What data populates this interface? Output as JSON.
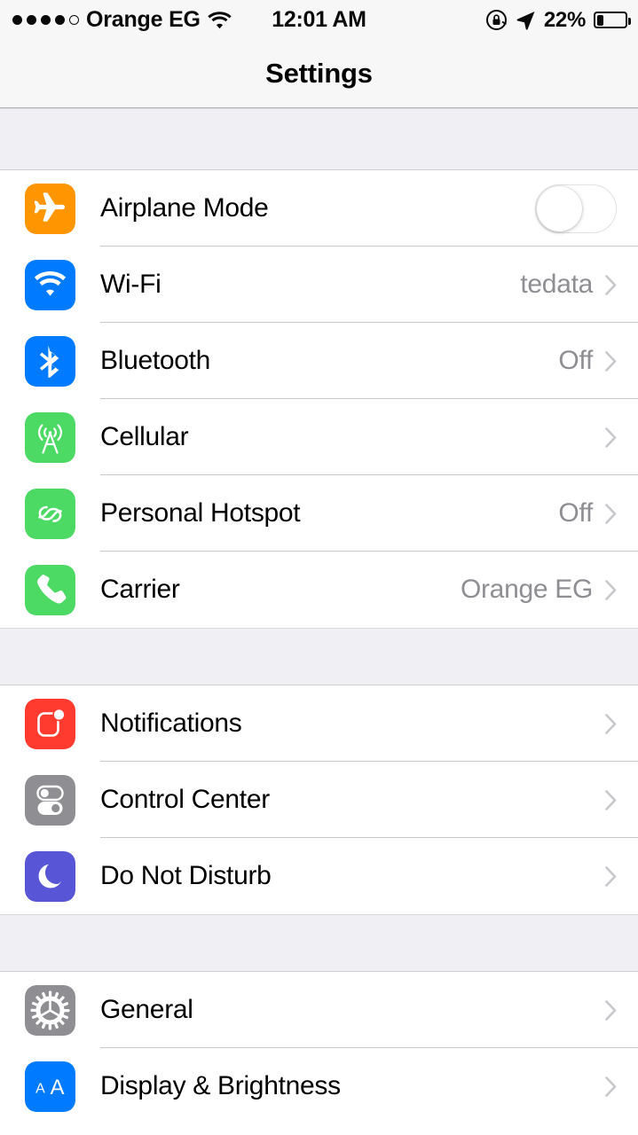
{
  "status_bar": {
    "signal_dots_filled": 4,
    "signal_dots_total": 5,
    "carrier": "Orange EG",
    "wifi_icon": "wifi-icon",
    "time": "12:01 AM",
    "rotation_lock_icon": "rotation-lock-icon",
    "location_icon": "location-arrow-icon",
    "battery_percent": "22%",
    "battery_level": 22
  },
  "navbar": {
    "title": "Settings"
  },
  "sections": [
    {
      "id": "connectivity",
      "rows": [
        {
          "label": "Airplane Mode",
          "icon": "airplane-icon",
          "icon_color": "#ff9500",
          "control": "toggle",
          "toggle_on": false
        },
        {
          "label": "Wi-Fi",
          "icon": "wifi-icon",
          "icon_color": "#007aff",
          "value": "tedata",
          "control": "chevron"
        },
        {
          "label": "Bluetooth",
          "icon": "bluetooth-icon",
          "icon_color": "#007aff",
          "value": "Off",
          "control": "chevron"
        },
        {
          "label": "Cellular",
          "icon": "cellular-antenna-icon",
          "icon_color": "#4cd964",
          "value": "",
          "control": "chevron"
        },
        {
          "label": "Personal Hotspot",
          "icon": "hotspot-link-icon",
          "icon_color": "#4cd964",
          "value": "Off",
          "control": "chevron"
        },
        {
          "label": "Carrier",
          "icon": "phone-icon",
          "icon_color": "#4cd964",
          "value": "Orange EG",
          "control": "chevron"
        }
      ]
    },
    {
      "id": "alerts",
      "rows": [
        {
          "label": "Notifications",
          "icon": "notifications-badge-icon",
          "icon_color": "#ff3b30",
          "value": "",
          "control": "chevron"
        },
        {
          "label": "Control Center",
          "icon": "control-center-toggles-icon",
          "icon_color": "#8e8e93",
          "value": "",
          "control": "chevron"
        },
        {
          "label": "Do Not Disturb",
          "icon": "moon-icon",
          "icon_color": "#5856d6",
          "value": "",
          "control": "chevron"
        }
      ]
    },
    {
      "id": "system",
      "rows": [
        {
          "label": "General",
          "icon": "gear-icon",
          "icon_color": "#8e8e93",
          "value": "",
          "control": "chevron"
        },
        {
          "label": "Display & Brightness",
          "icon": "text-size-aa-icon",
          "icon_color": "#007aff",
          "value": "",
          "control": "chevron",
          "icon_text": "AA"
        }
      ]
    }
  ],
  "colors": {
    "background": "#ffffff",
    "group_gap": "#efeff4",
    "separator": "#c8c7cc",
    "secondary_text": "#8e8e93",
    "navbar": "#f7f7f7"
  }
}
